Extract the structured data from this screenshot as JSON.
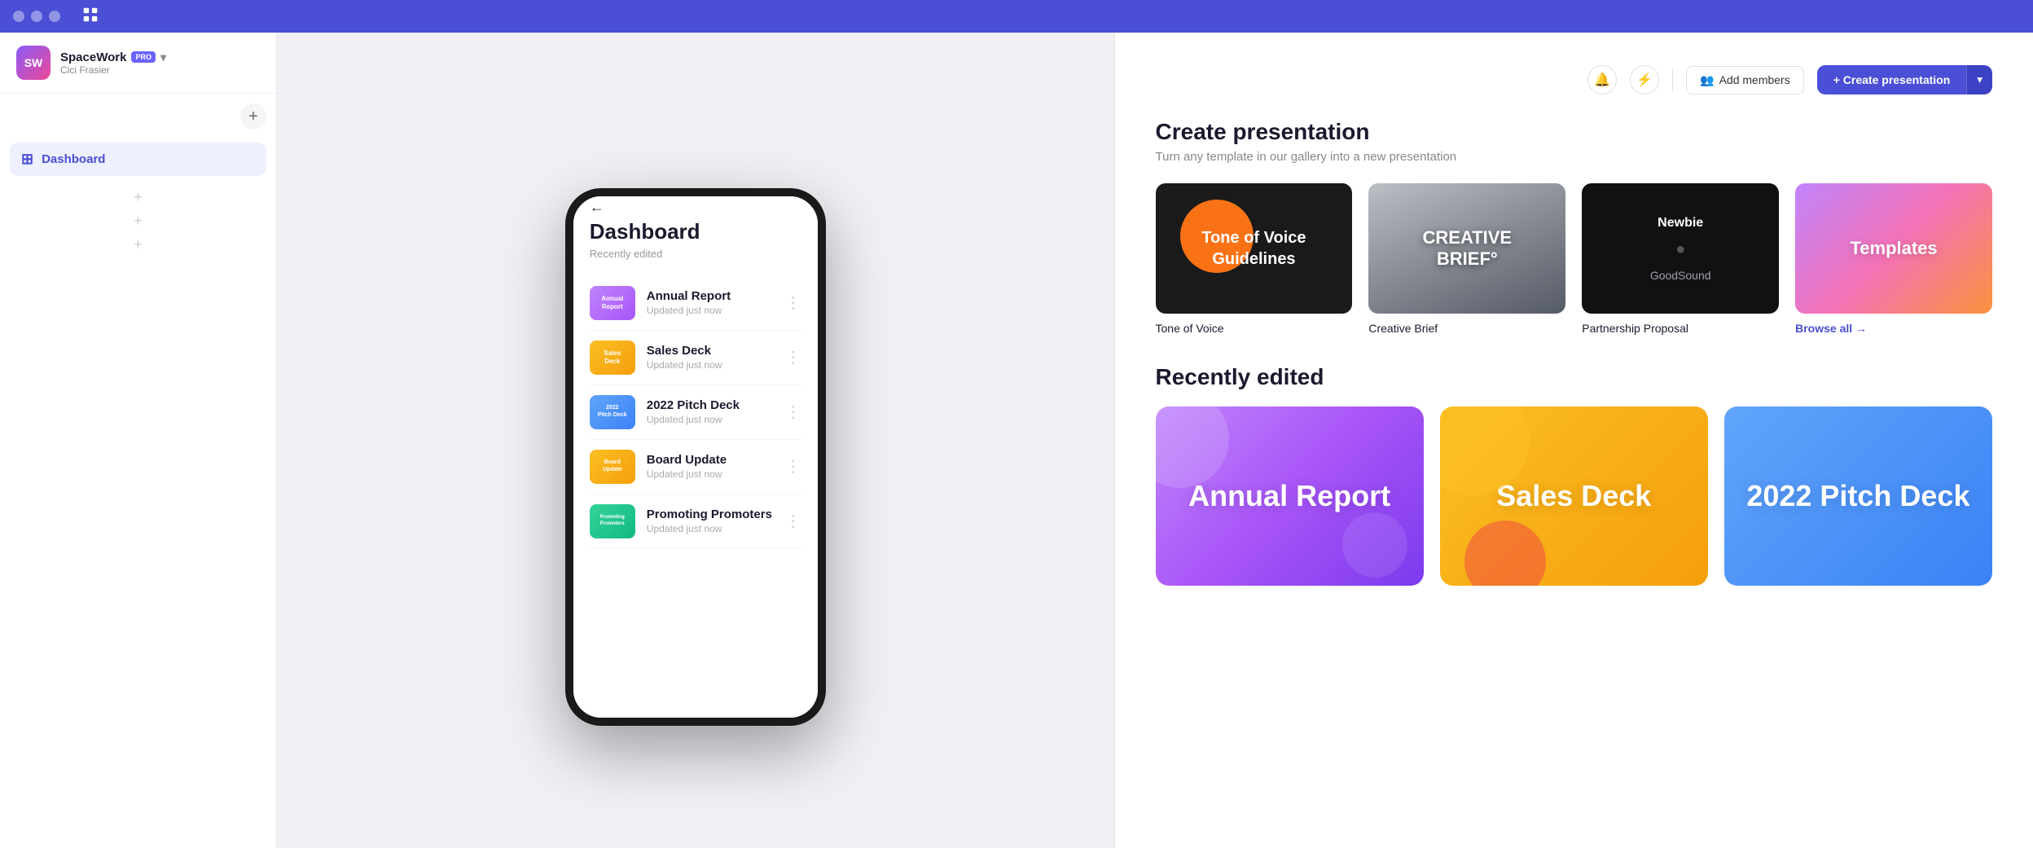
{
  "app": {
    "title": "SpaceWork Dashboard"
  },
  "topbar": {
    "app_icon": "grid"
  },
  "sidebar": {
    "workspace_name": "SpaceWork",
    "pro_badge": "PRO",
    "user_name": "Cici Frasier",
    "nav_items": [
      {
        "label": "Dashboard",
        "active": true
      }
    ]
  },
  "phone": {
    "dashboard_title": "Dashboard",
    "recently_edited": "Recently edited",
    "back_arrow": "←",
    "items": [
      {
        "title": "Annual Report",
        "updated": "Updated just now",
        "thumb_type": "annual"
      },
      {
        "title": "Sales Deck",
        "updated": "Updated just now",
        "thumb_type": "sales"
      },
      {
        "title": "2022 Pitch Deck",
        "updated": "Updated just now",
        "thumb_type": "pitch"
      },
      {
        "title": "Board Update",
        "updated": "Updated just now",
        "thumb_type": "board"
      },
      {
        "title": "Promoting Promoters",
        "updated": "Updated just now",
        "thumb_type": "promoting"
      }
    ]
  },
  "header": {
    "add_members_label": "Add members",
    "create_presentation_label": "+ Create presentation"
  },
  "create_section": {
    "title": "Create presentation",
    "subtitle": "Turn any template in our gallery into a new presentation",
    "templates": [
      {
        "label": "Tone of Voice",
        "type": "tone"
      },
      {
        "label": "Creative Brief",
        "type": "creative"
      },
      {
        "label": "Partnership Proposal",
        "type": "partnership"
      }
    ],
    "browse_all": "Browse all →"
  },
  "recently_section": {
    "title": "Recently edited",
    "items": [
      {
        "label": "Annual Report",
        "type": "annual"
      },
      {
        "label": "Sales Deck",
        "type": "sales"
      },
      {
        "label": "2022 Pitch Deck",
        "type": "pitch"
      }
    ]
  }
}
